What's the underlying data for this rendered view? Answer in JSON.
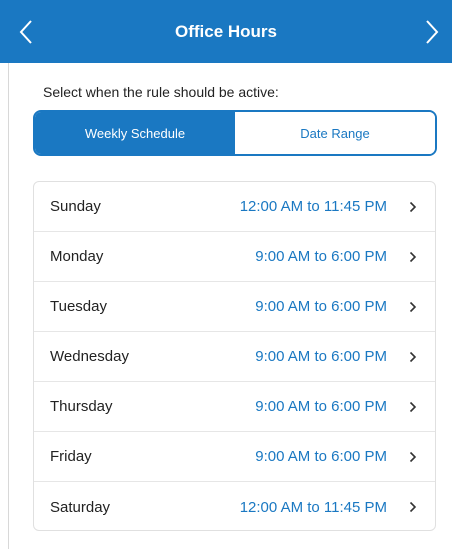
{
  "header": {
    "title": "Office Hours",
    "back_icon": "chevron-left-icon",
    "forward_icon": "chevron-right-icon"
  },
  "prompt": "Select when the rule should be active:",
  "schedule_mode": {
    "options": [
      "Weekly Schedule",
      "Date Range"
    ],
    "selected": "Weekly Schedule"
  },
  "days": [
    {
      "name": "Sunday",
      "hours": "12:00 AM to 11:45 PM"
    },
    {
      "name": "Monday",
      "hours": "9:00 AM to 6:00 PM"
    },
    {
      "name": "Tuesday",
      "hours": "9:00 AM to 6:00 PM"
    },
    {
      "name": "Wednesday",
      "hours": "9:00 AM to 6:00 PM"
    },
    {
      "name": "Thursday",
      "hours": "9:00 AM to 6:00 PM"
    },
    {
      "name": "Friday",
      "hours": "9:00 AM to 6:00 PM"
    },
    {
      "name": "Saturday",
      "hours": "12:00 AM to 11:45 PM"
    }
  ],
  "colors": {
    "accent": "#1a78c2",
    "text": "#222222",
    "border": "#e0e0e0"
  }
}
